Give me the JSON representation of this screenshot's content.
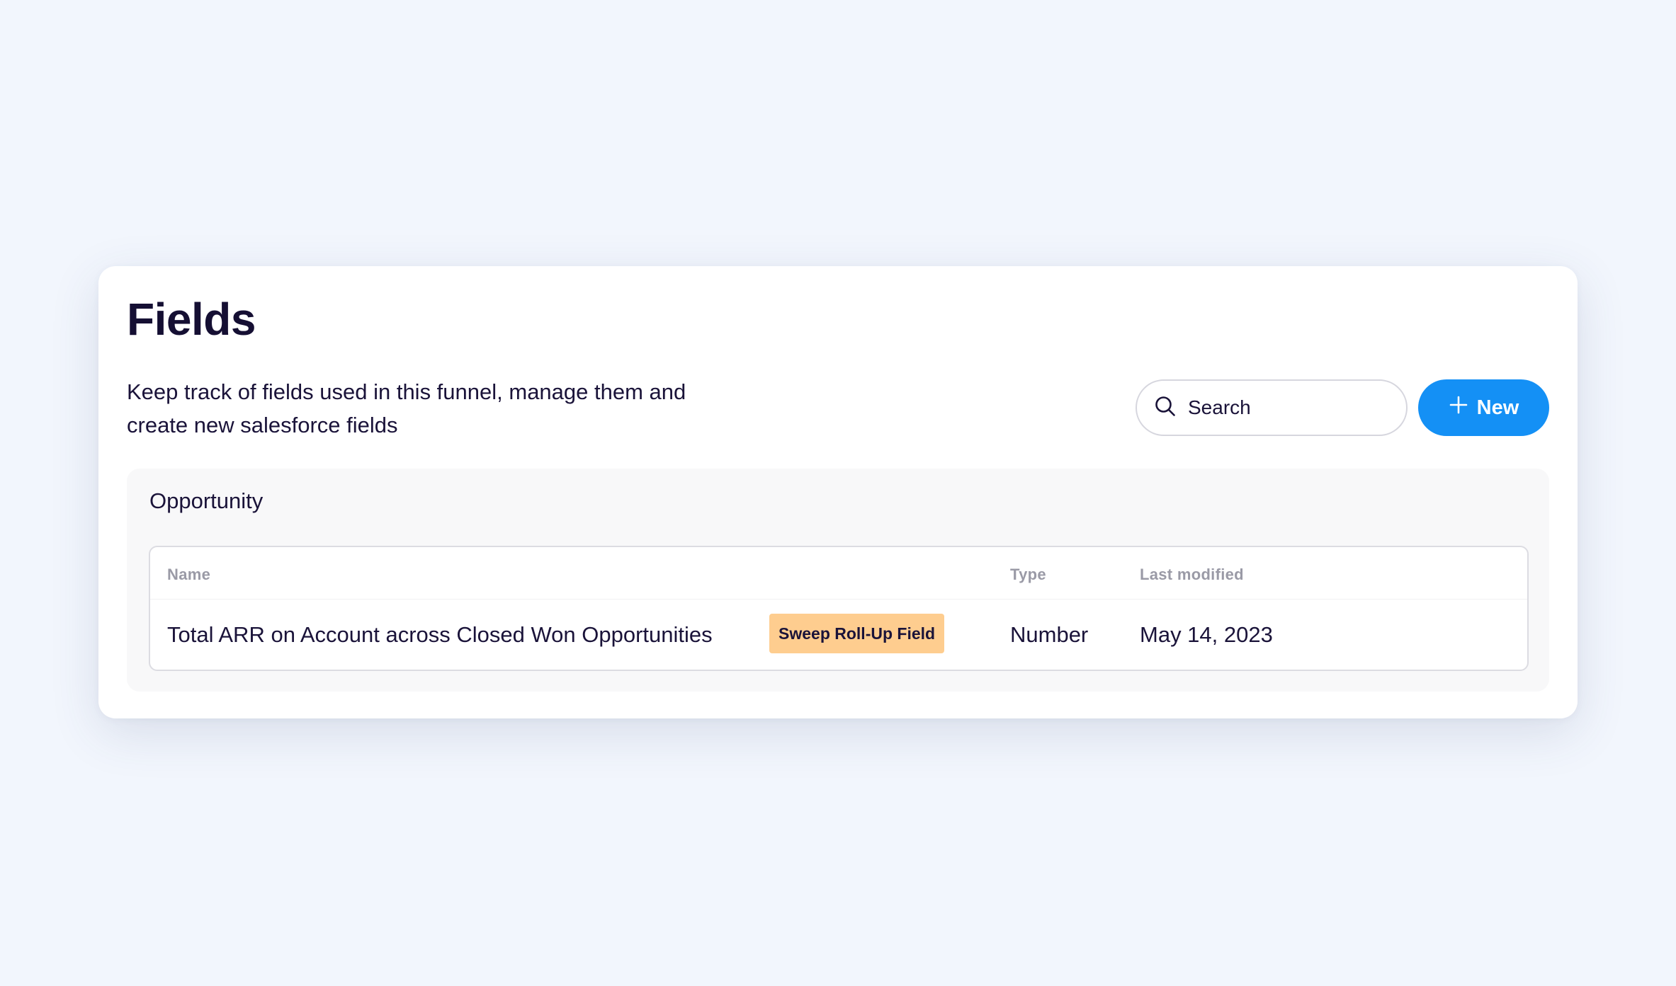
{
  "page": {
    "title": "Fields",
    "description_line1": "Keep track of fields used in this funnel, manage them and",
    "description_line2": "create new salesforce fields"
  },
  "search": {
    "placeholder": "Search",
    "icon": "search-icon"
  },
  "new_button": {
    "label": "New",
    "icon": "plus-icon"
  },
  "section": {
    "title": "Opportunity",
    "columns": {
      "name": "Name",
      "type": "Type",
      "last_modified": "Last modified"
    },
    "rows": [
      {
        "name": "Total ARR on Account across Closed Won Opportunities",
        "badge": "Sweep Roll-Up Field",
        "type": "Number",
        "last_modified": "May 14, 2023"
      }
    ]
  },
  "colors": {
    "background": "#f2f6fd",
    "primary": "#1490f5",
    "badge": "#fecd8f",
    "text": "#1a1339"
  }
}
